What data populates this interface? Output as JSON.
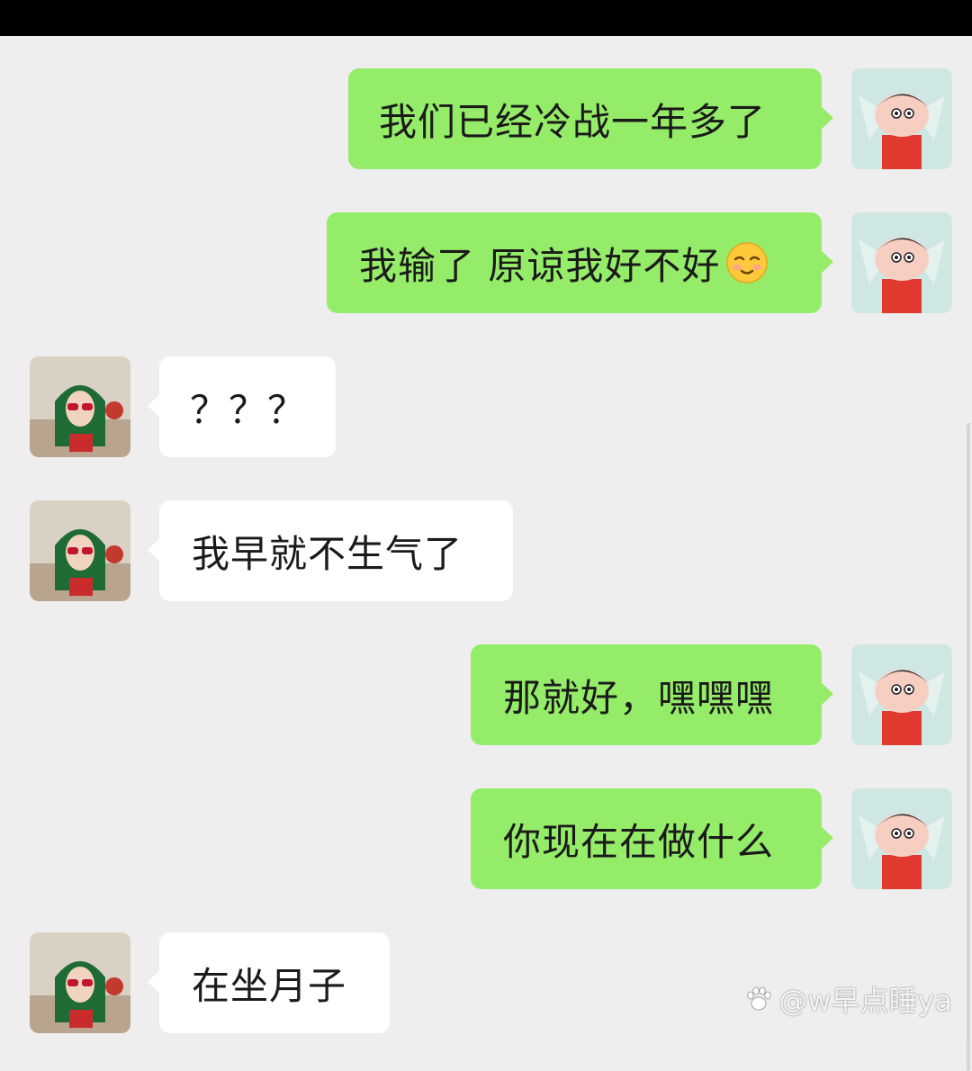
{
  "messages": [
    {
      "side": "out",
      "text": "我们已经冷战一年多了"
    },
    {
      "side": "out",
      "text": "我输了 原谅我好不好",
      "emoji": "shy-smile-emoji"
    },
    {
      "side": "in",
      "text": "？？？"
    },
    {
      "side": "in",
      "text": "我早就不生气了"
    },
    {
      "side": "out",
      "text": "那就好，嘿嘿嘿"
    },
    {
      "side": "out",
      "text": "你现在在做什么"
    },
    {
      "side": "in",
      "text": "在坐月子"
    }
  ],
  "watermark": {
    "icon": "paw-icon",
    "text": "@w早点睡ya"
  },
  "colors": {
    "outgoing_bubble": "#95ec69",
    "incoming_bubble": "#ffffff",
    "background": "#eeeeef"
  }
}
